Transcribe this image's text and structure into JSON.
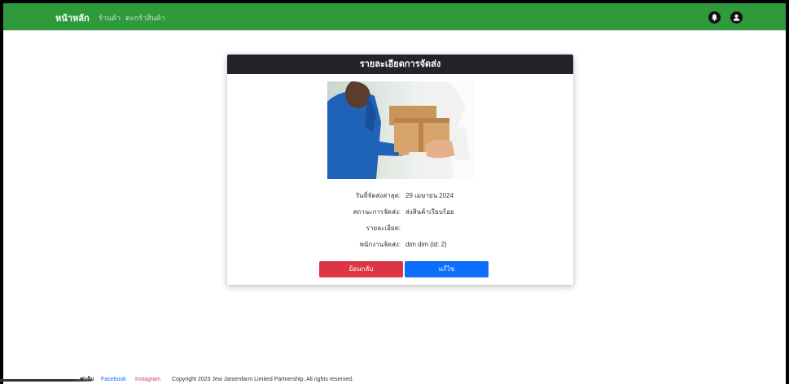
{
  "navbar": {
    "brand": "หน้าหลัก",
    "links": [
      "ร้านค้า",
      "ตะกร้าสินค้า"
    ],
    "icons": [
      "bell-icon",
      "user-icon"
    ],
    "color": "#2f9a3b"
  },
  "card": {
    "title": "รายละเอียดการจัดส่ง",
    "header_color": "#212529",
    "photo_alt": "",
    "details": [
      {
        "label": "วันที่จัดส่งล่าสุด:",
        "value": "29 เมษายน 2024"
      },
      {
        "label": "สถานะการจัดส่ง:",
        "value": "ส่งสินค้าเรียบร้อย"
      },
      {
        "label": "รายละเอียด:",
        "value": ""
      },
      {
        "label": "พนักงานจัดส่ง:",
        "value": "dim dim (id: 2)"
      }
    ],
    "buttons": {
      "back": "ย้อนกลับ",
      "edit": "แก้ไข",
      "back_color": "#dc3545",
      "edit_color": "#0d6efd"
    }
  },
  "footer": {
    "company": "ฟาร์ม",
    "facebook": "Facebook",
    "instagram": "Instagram",
    "copyright": "Copyright 2023 Jew Jaroenfarm Limited Partnership. All rights reserved."
  }
}
